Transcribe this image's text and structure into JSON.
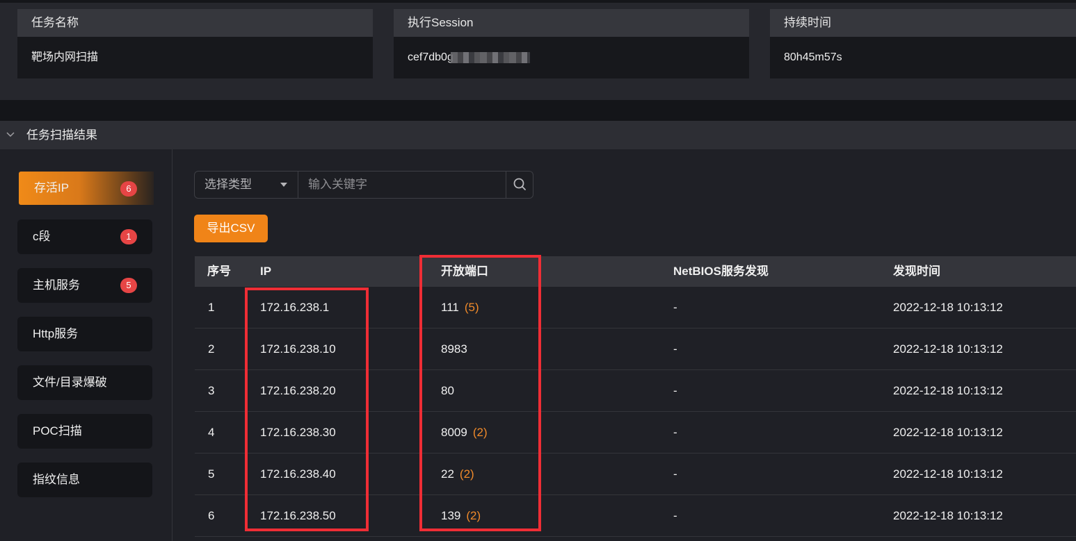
{
  "info": {
    "task_name_label": "任务名称",
    "task_name_value": "靶场内网扫描",
    "session_label": "执行Session",
    "session_value": "cef7db0g",
    "duration_label": "持续时间",
    "duration_value": "80h45m57s"
  },
  "section": {
    "title": "任务扫描结果",
    "chevron_icon": "chevron-down-icon"
  },
  "nav": {
    "items": [
      {
        "label": "存活IP",
        "badge": "6"
      },
      {
        "label": "c段",
        "badge": "1"
      },
      {
        "label": "主机服务",
        "badge": "5"
      },
      {
        "label": "Http服务"
      },
      {
        "label": "文件/目录爆破"
      },
      {
        "label": "POC扫描"
      },
      {
        "label": "指纹信息"
      }
    ],
    "active_gradient_color": "#f08a18",
    "badge_color": "#e64545"
  },
  "filter": {
    "type_placeholder": "选择类型",
    "keyword_placeholder": "输入关键字",
    "search_icon": "search-icon"
  },
  "toolbar": {
    "export_label": "导出CSV",
    "accent": "#f08418"
  },
  "table": {
    "headers": {
      "idx": "序号",
      "ip": "IP",
      "ports": "开放端口",
      "netbios": "NetBIOS服务发现",
      "time": "发现时间"
    },
    "rows": [
      {
        "idx": "1",
        "ip": "172.16.238.1",
        "port": "111",
        "count": "(5)",
        "netbios": "-",
        "time": "2022-12-18 10:13:12"
      },
      {
        "idx": "2",
        "ip": "172.16.238.10",
        "port": "8983",
        "count": "",
        "netbios": "-",
        "time": "2022-12-18 10:13:12"
      },
      {
        "idx": "3",
        "ip": "172.16.238.20",
        "port": "80",
        "count": "",
        "netbios": "-",
        "time": "2022-12-18 10:13:12"
      },
      {
        "idx": "4",
        "ip": "172.16.238.30",
        "port": "8009",
        "count": "(2)",
        "netbios": "-",
        "time": "2022-12-18 10:13:12"
      },
      {
        "idx": "5",
        "ip": "172.16.238.40",
        "port": "22",
        "count": "(2)",
        "netbios": "-",
        "time": "2022-12-18 10:13:12"
      },
      {
        "idx": "6",
        "ip": "172.16.238.50",
        "port": "139",
        "count": "(2)",
        "netbios": "-",
        "time": "2022-12-18 10:13:12"
      }
    ]
  },
  "annotation_color": "#ef2d35"
}
